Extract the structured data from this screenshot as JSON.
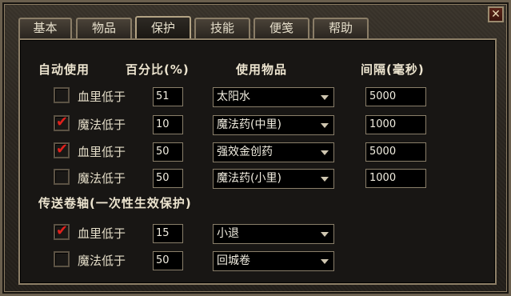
{
  "tabs": [
    "基本",
    "物品",
    "保护",
    "技能",
    "便笺",
    "帮助"
  ],
  "active_tab": "保护",
  "headers": {
    "auto_use": "自动使用",
    "percent": "百分比(%)",
    "item": "使用物品",
    "interval": "间隔(毫秒)",
    "scroll": "传送卷轴(一次性生效保护)"
  },
  "auto_rows": [
    {
      "checked": false,
      "label": "血里低于",
      "percent": "51",
      "item": "太阳水",
      "interval": "5000"
    },
    {
      "checked": true,
      "label": "魔法低于",
      "percent": "10",
      "item": "魔法药(中里)",
      "interval": "1000"
    },
    {
      "checked": true,
      "label": "血里低于",
      "percent": "50",
      "item": "强效金创药",
      "interval": "5000"
    },
    {
      "checked": false,
      "label": "魔法低于",
      "percent": "50",
      "item": "魔法药(小里)",
      "interval": "1000"
    }
  ],
  "scroll_rows": [
    {
      "checked": true,
      "label": "血里低于",
      "percent": "15",
      "item": "小退"
    },
    {
      "checked": false,
      "label": "魔法低于",
      "percent": "50",
      "item": "回城卷"
    }
  ],
  "close_glyph": "✕",
  "check_glyph": "✔",
  "colors": {
    "check": "#e0211c",
    "field_bg": "#000000",
    "frame": "#8d7f67"
  }
}
